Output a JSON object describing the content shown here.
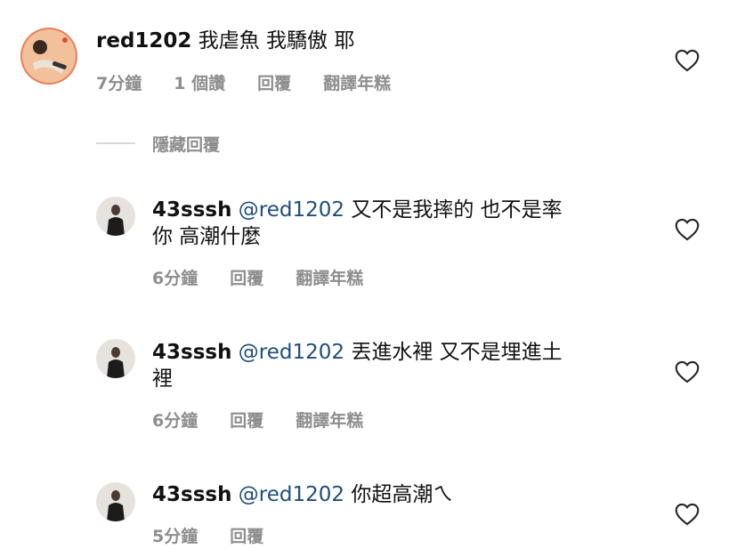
{
  "comments": [
    {
      "username": "red1202",
      "mention": "",
      "text": "我虐魚 我驕傲 耶",
      "line2": "",
      "time": "7分鐘",
      "likes": "1 個讚",
      "reply": "回覆",
      "translate": "翻譯年糕"
    },
    {
      "username": "43sssh",
      "mention": "@red1202",
      "text": "又不是我摔的 也不是率",
      "line2": "你 高潮什麼",
      "time": "6分鐘",
      "likes": "",
      "reply": "回覆",
      "translate": "翻譯年糕"
    },
    {
      "username": "43sssh",
      "mention": "@red1202",
      "text": "丟進水裡 又不是埋進土",
      "line2": "裡",
      "time": "6分鐘",
      "likes": "",
      "reply": "回覆",
      "translate": "翻譯年糕"
    },
    {
      "username": "43sssh",
      "mention": "@red1202",
      "text": "你超高潮ㄟ",
      "line2": "",
      "time": "5分鐘",
      "likes": "",
      "reply": "回覆",
      "translate": ""
    }
  ],
  "replies_toggle": {
    "label": "隱藏回覆"
  },
  "colors": {
    "mention": "#1f4e79",
    "meta": "#8e8e8e"
  },
  "icons": {
    "like": "heart-outline-icon"
  }
}
